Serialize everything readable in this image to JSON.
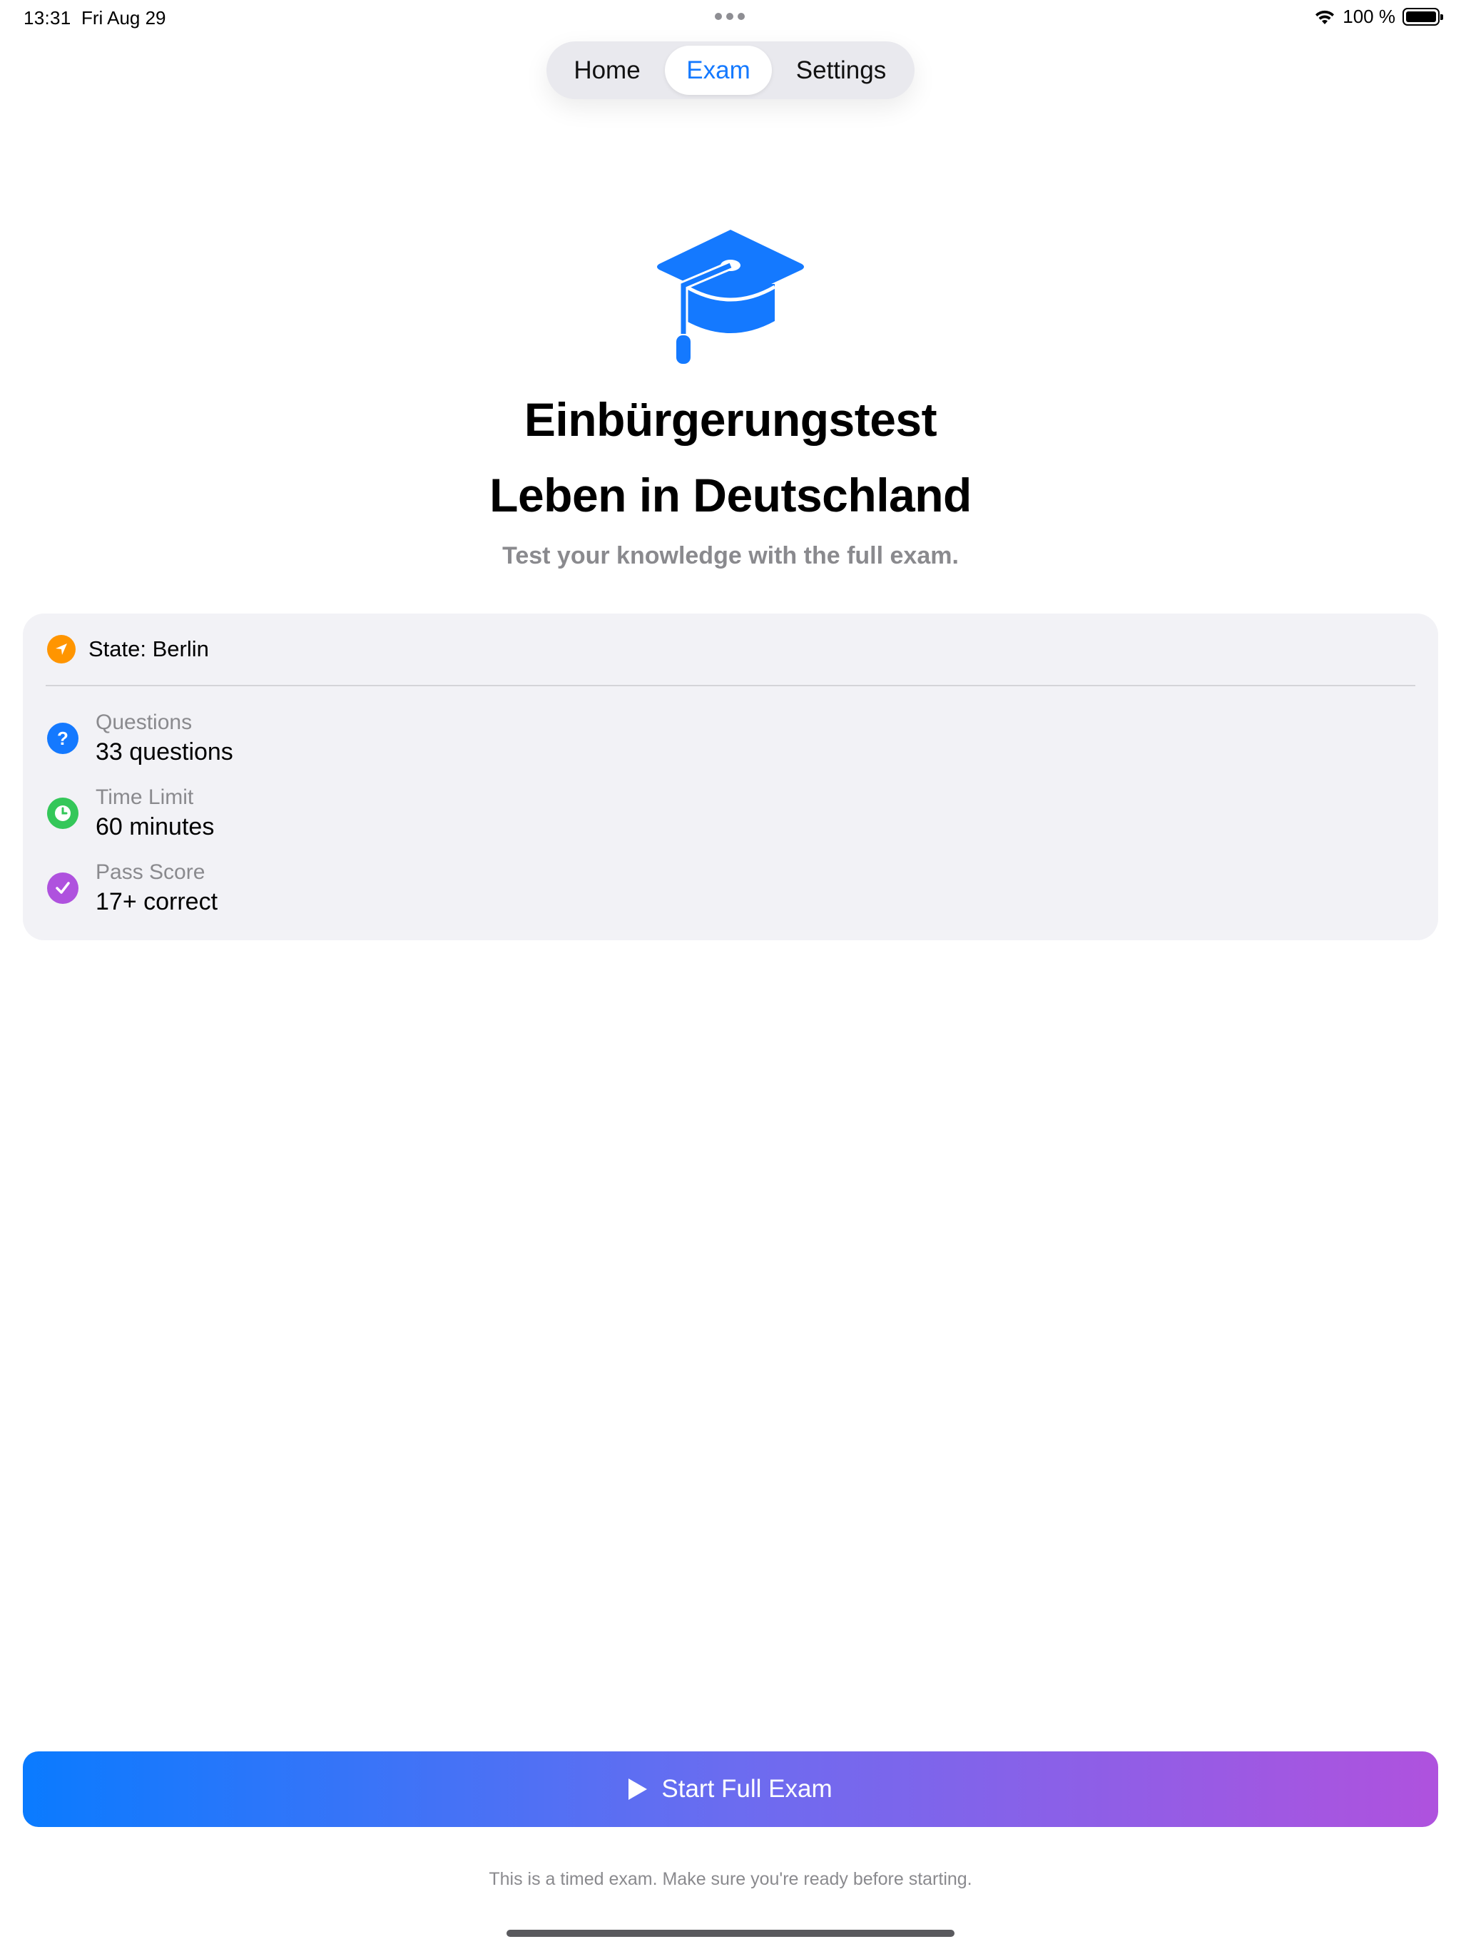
{
  "status_bar": {
    "time": "13:31",
    "date": "Fri Aug 29",
    "battery": "100 %",
    "icons": [
      "wifi-icon",
      "battery-icon",
      "multitasking-dots-icon"
    ]
  },
  "nav": {
    "tabs": [
      {
        "label": "Home"
      },
      {
        "label": "Exam"
      },
      {
        "label": "Settings"
      }
    ],
    "selected": "Exam"
  },
  "hero": {
    "icon": "graduation-cap-icon",
    "title_line1": "Einbürgerungstest",
    "title_line2": "Leben in Deutschland",
    "subtitle": "Test your knowledge with the full exam."
  },
  "info_card": {
    "state": {
      "icon": "location-arrow-icon",
      "text": "State: Berlin"
    },
    "rows": [
      {
        "icon": "question-mark-icon",
        "label": "Questions",
        "value": "33 questions"
      },
      {
        "icon": "clock-icon",
        "label": "Time Limit",
        "value": "60 minutes"
      },
      {
        "icon": "checkmark-icon",
        "label": "Pass Score",
        "value": "17+ correct"
      }
    ]
  },
  "actions": {
    "start_label": "Start Full Exam",
    "note": "This is a timed exam. Make sure you're ready before starting."
  },
  "colors": {
    "accent": "#1479ff",
    "orange": "#ff9500",
    "green": "#34c759",
    "purple": "#af52de",
    "gradient_start": "#0a7bff",
    "gradient_end": "#af52de"
  }
}
